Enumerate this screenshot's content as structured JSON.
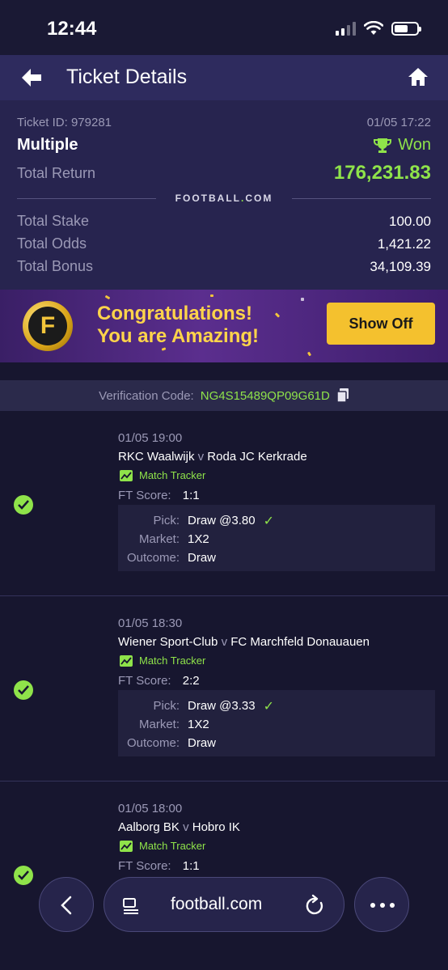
{
  "status_bar": {
    "time": "12:44"
  },
  "header": {
    "title": "Ticket Details"
  },
  "summary": {
    "ticket_id": "Ticket ID: 979281",
    "datetime": "01/05 17:22",
    "bet_type": "Multiple",
    "status": "Won",
    "total_return_label": "Total Return",
    "total_return": "176,231.83",
    "brand": "FOOTBALL.COM",
    "total_stake_label": "Total Stake",
    "total_stake": "100.00",
    "total_odds_label": "Total Odds",
    "total_odds": "1,421.22",
    "total_bonus_label": "Total Bonus",
    "total_bonus": "34,109.39"
  },
  "banner": {
    "line1": "Congratulations!",
    "line2": "You are Amazing!",
    "button": "Show Off"
  },
  "verification": {
    "label": "Verification Code:",
    "code": "NG4S15489QP09G61D"
  },
  "matches": [
    {
      "datetime": "01/05 19:00",
      "home": "RKC Waalwijk",
      "vs": "v",
      "away": "Roda JC Kerkrade",
      "tracker": "Match Tracker",
      "score_label": "FT Score:",
      "score": "1:1",
      "pick_label": "Pick:",
      "pick": "Draw @3.80",
      "market_label": "Market:",
      "market": "1X2",
      "outcome_label": "Outcome:",
      "outcome": "Draw"
    },
    {
      "datetime": "01/05 18:30",
      "home": "Wiener Sport-Club",
      "vs": "v",
      "away": "FC Marchfeld Donauauen",
      "tracker": "Match Tracker",
      "score_label": "FT Score:",
      "score": "2:2",
      "pick_label": "Pick:",
      "pick": "Draw @3.33",
      "market_label": "Market:",
      "market": "1X2",
      "outcome_label": "Outcome:",
      "outcome": "Draw"
    },
    {
      "datetime": "01/05 18:00",
      "home": "Aalborg BK",
      "vs": "v",
      "away": "Hobro IK",
      "tracker": "Match Tracker",
      "score_label": "FT Score:",
      "score": "1:1"
    }
  ],
  "browser": {
    "url": "football.com"
  },
  "colors": {
    "accent_green": "#8fe34a",
    "header_bg": "#2e2b5e",
    "summary_bg": "#27244f",
    "show_off_yellow": "#f4c12e"
  }
}
